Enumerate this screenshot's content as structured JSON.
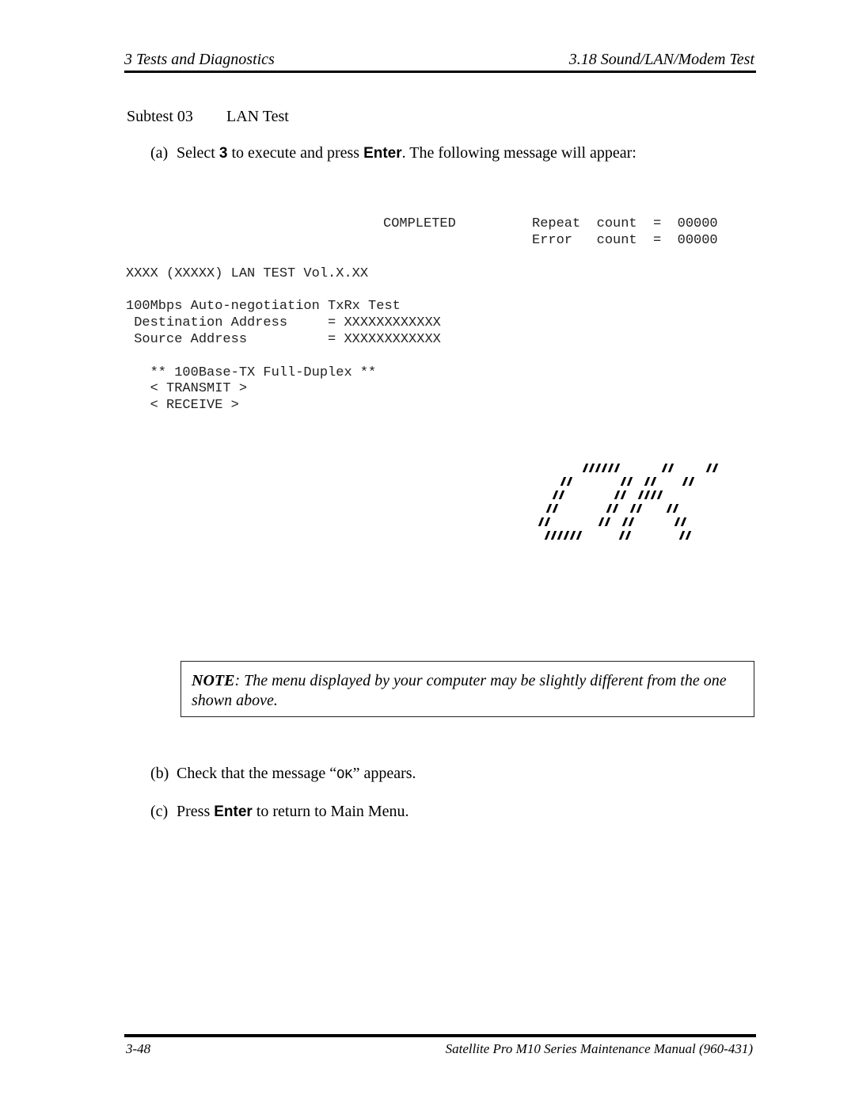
{
  "header": {
    "chapter": "3   Tests and Diagnostics",
    "section": "3.18  Sound/LAN/Modem Test"
  },
  "subtest": {
    "number": "Subtest 03",
    "name": "LAN Test"
  },
  "steps": {
    "a": {
      "label": "(a)",
      "pre": "Select ",
      "key1": "3",
      "mid": " to execute and press ",
      "key2": "Enter",
      "post": ". The following message will appear:"
    },
    "b": {
      "label": "(b)",
      "pre": "Check that the message “",
      "code": "OK",
      "post": "” appears."
    },
    "c": {
      "label": "(c)",
      "pre": "Press ",
      "key": "Enter",
      "post": " to return to Main Menu."
    }
  },
  "screen": {
    "status": "COMPLETED",
    "repeat_count": "Repeat  count  =  00000",
    "error_count": "Error   count  =  00000",
    "title": "XXXX (XXXXX) LAN TEST Vol.X.XX",
    "test_line": "100Mbps Auto-negotiation TxRx Test",
    "dest_address": " Destination Address     = XXXXXXXXXXXX",
    "src_address": " Source Address          = XXXXXXXXXXXX",
    "mode": "   ** 100Base-TX Full-Duplex **",
    "transmit": "   < TRANSMIT >",
    "receive": "   < RECEIVE >",
    "ok_art_text": "OK"
  },
  "note": {
    "label": "NOTE",
    "text": ": The menu displayed by your computer may be slightly different from the one shown above."
  },
  "footer": {
    "page": "3-48",
    "manual": "Satellite Pro M10 Series Maintenance Manual (960-431)"
  }
}
